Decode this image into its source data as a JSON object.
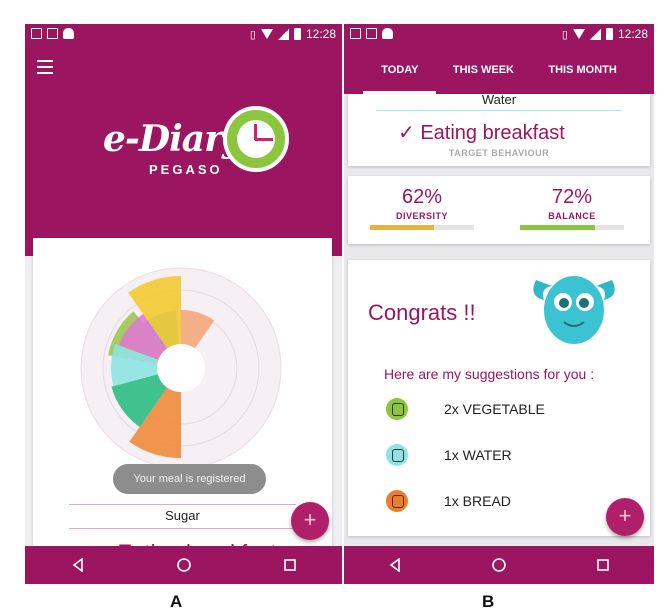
{
  "status_bar": {
    "time": "12:28"
  },
  "tabs": [
    "TODAY",
    "THIS WEEK",
    "THIS MONTH"
  ],
  "screen_a": {
    "logo_main": "e-Diary",
    "logo_sub": "PEGASO",
    "toast": "Your meal is registered",
    "sugar_label": "Sugar",
    "cut_text": "✓ Eating breakfast",
    "fab": "+",
    "chart_colors": [
      "#f3c930",
      "#f08a3c",
      "#2dbb82",
      "#8fe3e2",
      "#e07ad0",
      "#f5a77a",
      "#9dc753",
      "#5ab4e6"
    ]
  },
  "screen_b": {
    "water_label": "Water",
    "target_check": "✓ Eating breakfast",
    "target_caption": "TARGET BEHAVIOUR",
    "diversity": {
      "value": "62%",
      "label": "DIVERSITY",
      "fraction": 0.62,
      "color": "#e8b33c"
    },
    "balance": {
      "value": "72%",
      "label": "BALANCE",
      "fraction": 0.72,
      "color": "#8cc63f"
    },
    "congrats": "Congrats !!",
    "suggestions_title": "Here are my suggestions for you :",
    "suggestions": [
      {
        "text": "2x VEGETABLE",
        "icon": "vegetable-icon",
        "color": "#8cc63f"
      },
      {
        "text": "1x WATER",
        "icon": "water-glass-icon",
        "color": "#8fe3e2"
      },
      {
        "text": "1x BREAD",
        "icon": "bread-icon",
        "color": "#f07c2a"
      }
    ],
    "fab": "+"
  },
  "captions": [
    "A",
    "B"
  ]
}
